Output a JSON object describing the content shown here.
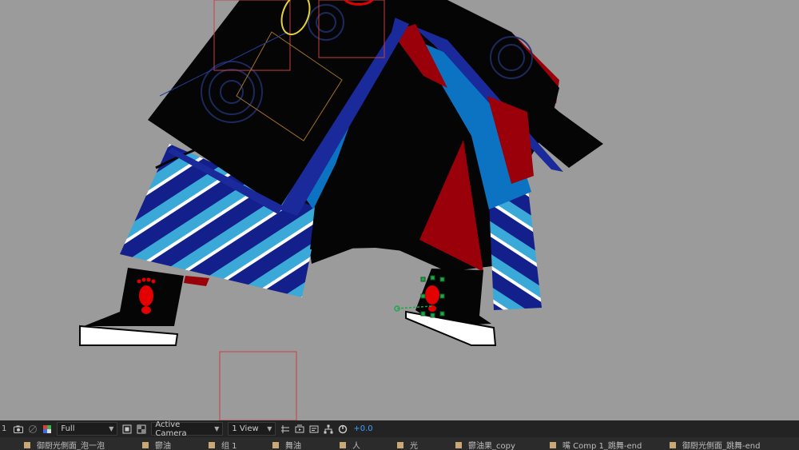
{
  "viewer": {
    "frame_number": "1",
    "resolution": "Full",
    "camera": "Active Camera",
    "views": "1 View",
    "exposure": "+0.0"
  },
  "icons": {
    "snapshot": "camera-icon",
    "show_snapshot": "show-snapshot-icon",
    "color": "color-channel-icon",
    "region": "region-of-interest-icon",
    "transparency": "transparency-grid-icon",
    "fast_previews": "fast-previews-icon",
    "timeline": "timeline-icon",
    "flowchart": "flowchart-icon",
    "reset_exposure": "reset-exposure-icon"
  },
  "layers": [
    "御厨光側面_泡一泡",
    "鬱油",
    "组 1",
    "舞油",
    "人",
    "光",
    "鬱油果_copy",
    "嘴 Comp 1_跳舞-end",
    "御厨光側面_跳舞-end"
  ],
  "colors": {
    "accent": "#3fa0ff",
    "coat": "#050505",
    "navy": "#1b2a9a",
    "blue": "#0c72c2",
    "red": "#9a0009",
    "stripe_light": "#3aa9d8",
    "foot_mark": "#e20000",
    "motion_path": "#1fa74a"
  }
}
